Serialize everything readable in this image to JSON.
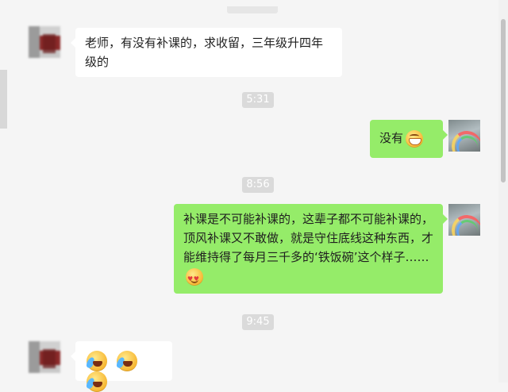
{
  "messages": [
    {
      "side": "left",
      "text": "老师，有没有补课的，求收留，三年级升四年级的"
    },
    {
      "time": "5:31"
    },
    {
      "side": "right",
      "text": "没有",
      "emoji": "grinning-face"
    },
    {
      "time": "8:56"
    },
    {
      "side": "right",
      "text": "补课是不可能补课的，这辈子都不可能补课的，顶风补课又不敢做，就是守住底线这种东西，才能维持得了每月三千多的‘铁饭碗’这个样子……",
      "emoji": "heart-eyes-face"
    },
    {
      "time": "9:45"
    },
    {
      "side": "left",
      "emojis": [
        "crying-laughing-face",
        "crying-laughing-face",
        "crying-laughing-face"
      ]
    }
  ],
  "colors": {
    "background": "#f5f5f5",
    "outgoing_bubble": "#95ec69",
    "incoming_bubble": "#ffffff",
    "time_badge": "#dadada"
  }
}
